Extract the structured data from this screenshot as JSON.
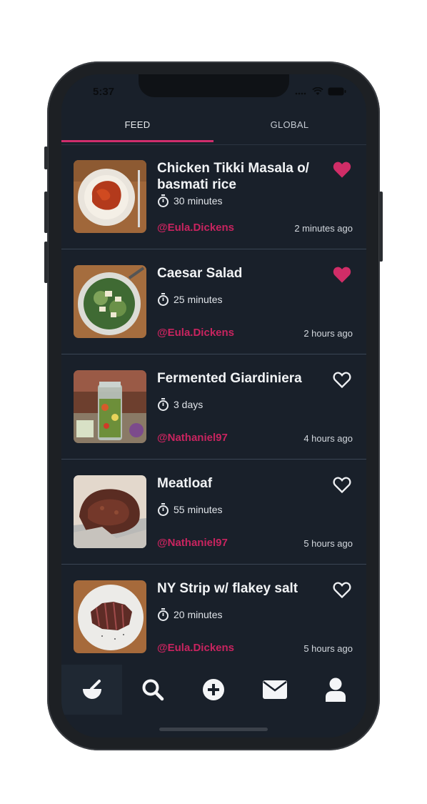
{
  "status_bar": {
    "time": "5:37"
  },
  "tabs": [
    {
      "label": "FEED",
      "active": true
    },
    {
      "label": "GLOBAL",
      "active": false
    }
  ],
  "feed": [
    {
      "title": "Chicken Tikki Masala o/ basmati rice",
      "duration": "30 minutes",
      "author": "@Eula.Dickens",
      "time_ago": "2 minutes ago",
      "liked": true,
      "image": "tikka-masala"
    },
    {
      "title": "Caesar Salad",
      "duration": "25 minutes",
      "author": "@Eula.Dickens",
      "time_ago": "2 hours ago",
      "liked": true,
      "image": "caesar-salad"
    },
    {
      "title": "Fermented Giardiniera",
      "duration": "3 days",
      "author": "@Nathaniel97",
      "time_ago": "4 hours ago",
      "liked": false,
      "image": "giardiniera-jar"
    },
    {
      "title": "Meatloaf",
      "duration": "55 minutes",
      "author": "@Nathaniel97",
      "time_ago": "5 hours ago",
      "liked": false,
      "image": "meatloaf"
    },
    {
      "title": "NY Strip w/ flakey salt",
      "duration": "20 minutes",
      "author": "@Eula.Dickens",
      "time_ago": "5 hours ago",
      "liked": false,
      "image": "ny-strip"
    }
  ],
  "bottom_nav": [
    {
      "icon": "mortar-pestle-icon",
      "active": true
    },
    {
      "icon": "search-icon",
      "active": false
    },
    {
      "icon": "plus-circle-icon",
      "active": false
    },
    {
      "icon": "envelope-icon",
      "active": false
    },
    {
      "icon": "user-icon",
      "active": false
    }
  ],
  "colors": {
    "accent": "#cf2d6c",
    "author": "#c8245f",
    "background": "#19202a"
  }
}
